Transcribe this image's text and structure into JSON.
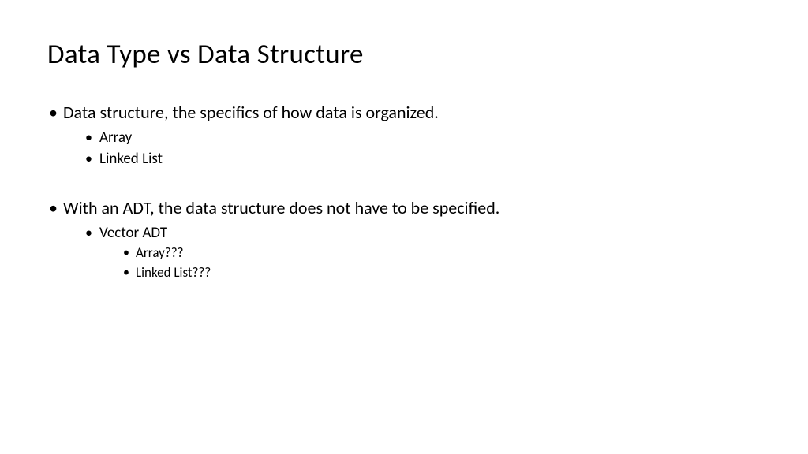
{
  "slide": {
    "title": "Data Type vs Data Structure",
    "bullets": {
      "b1": "Data structure, the specifics of how data is organized.",
      "b1_1": "Array",
      "b1_2": "Linked List",
      "b2": "With an ADT, the data structure does not have to be specified.",
      "b2_1": "Vector ADT",
      "b2_1_1": "Array???",
      "b2_1_2": "Linked List???"
    }
  }
}
